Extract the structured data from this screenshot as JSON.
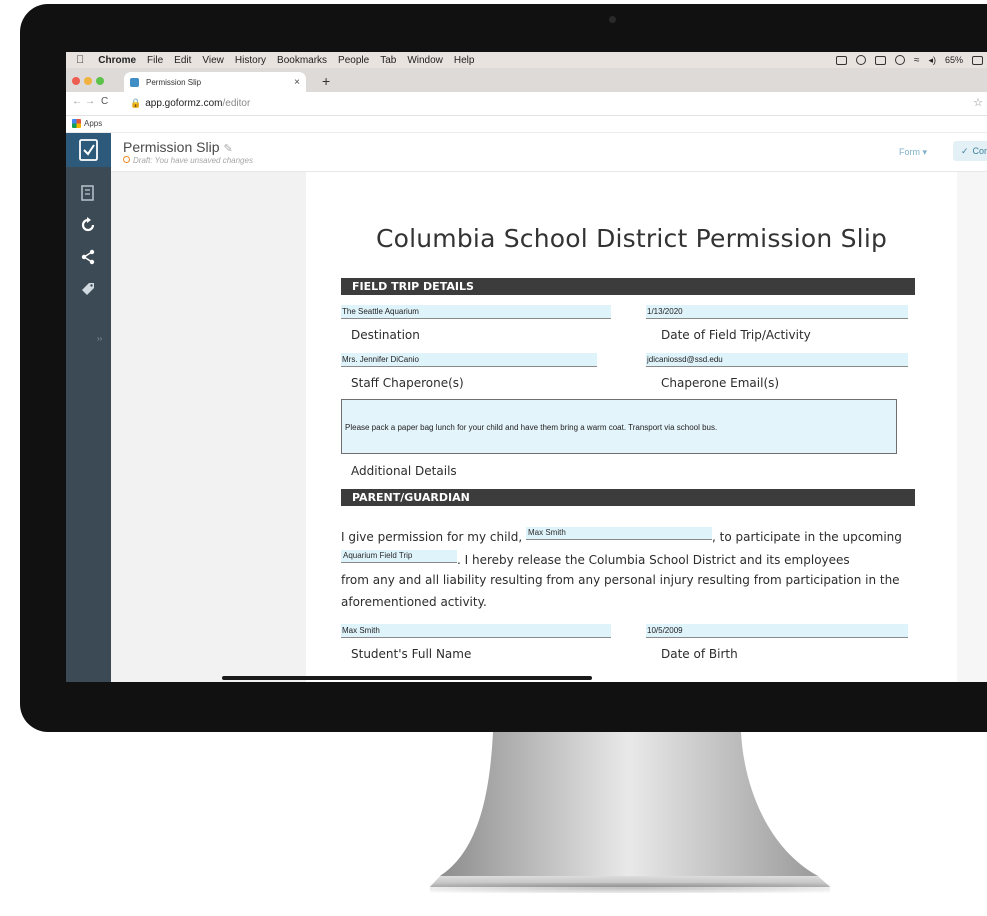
{
  "menubar": {
    "apple": "",
    "items": [
      "Chrome",
      "File",
      "Edit",
      "View",
      "History",
      "Bookmarks",
      "People",
      "Tab",
      "Window",
      "Help"
    ],
    "battery": "65%"
  },
  "browser": {
    "tab_title": "Permission Slip",
    "tab_close": "×",
    "new_tab": "+",
    "back": "←",
    "forward": "→",
    "reload": "C",
    "url_host": "app.goformz.com",
    "url_path": "/editor",
    "star": "☆",
    "apps_label": "Apps"
  },
  "app": {
    "form_name": "Permission Slip",
    "draft_text": "Draft: You have unsaved changes",
    "form_dropdown": "Form",
    "complete_label": "Complete"
  },
  "form": {
    "title": "Columbia School District Permission Slip",
    "section_trip": "FIELD TRIP DETAILS",
    "section_parent": "PARENT/GUARDIAN",
    "destination_value": "The Seattle Aquarium",
    "destination_label": "Destination",
    "date_value": "1/13/2020",
    "date_label": "Date of Field Trip/Activity",
    "chaperone_value": "Mrs. Jennifer DiCanio",
    "chaperone_label": "Staff Chaperone(s)",
    "email_value": "jdicaniossd@ssd.edu",
    "email_label": "Chaperone Email(s)",
    "details_value": "Please pack a paper bag lunch for your child and have them bring a warm coat. Transport via school bus.",
    "details_label": "Additional Details",
    "para_1a": "I give permission for my child,",
    "child_value": "Max Smith",
    "para_1b": ", to participate in the upcoming",
    "trip_value": "Aquarium Field Trip",
    "para_2": ". I hereby release the Columbia School District and its employees",
    "para_3": "from  any and all liability resulting from any personal injury resulting from participation in the",
    "para_4": "aforementioned activity.",
    "student_value": "Max Smith",
    "student_label": "Student's Full Name",
    "dob_value": "10/5/2009",
    "dob_label": "Date of Birth"
  },
  "colors": {
    "sidebar": "#3c4a55",
    "sidebar_active": "#2d5a7a",
    "field_fill": "#dff3fb",
    "section_bar": "#3c3c3c",
    "complete_btn": "#e3f0f5"
  },
  "icons": {
    "sidebar": [
      "form-check-icon",
      "list-icon",
      "refresh-icon",
      "share-icon",
      "tag-icon"
    ]
  }
}
